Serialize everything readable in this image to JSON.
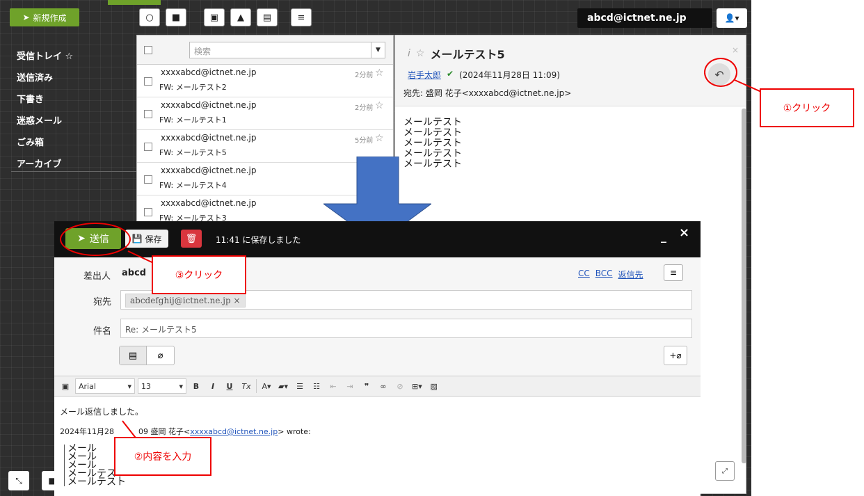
{
  "background": {
    "compose_label": "新規作成",
    "account": "abcd@ictnet.ne.jp",
    "folders": [
      {
        "label": "受信トレイ ☆"
      },
      {
        "label": "送信済み"
      },
      {
        "label": "下書き"
      },
      {
        "label": "迷惑メール"
      },
      {
        "label": "ごみ箱"
      },
      {
        "label": "アーカイブ"
      }
    ],
    "search_placeholder": "検索",
    "messages": [
      {
        "from": "xxxxabcd@ictnet.ne.jp",
        "subject": "FW: メールテスト2",
        "time": "2分前"
      },
      {
        "from": "xxxxabcd@ictnet.ne.jp",
        "subject": "FW: メールテスト1",
        "time": "2分前"
      },
      {
        "from": "xxxxabcd@ictnet.ne.jp",
        "subject": "FW: メールテスト5",
        "time": "5分前"
      },
      {
        "from": "xxxxabcd@ictnet.ne.jp",
        "subject": "FW: メールテスト4",
        "time": ""
      },
      {
        "from": "xxxxabcd@ictnet.ne.jp",
        "subject": "FW: メールテスト3",
        "time": ""
      }
    ],
    "reading": {
      "title": "メールテスト5",
      "sender": "岩手太郎",
      "date": "(2024年11月28日 11:09)",
      "to_label": "宛先:",
      "to_value": "盛岡 花子<xxxxabcd@ictnet.ne.jp>",
      "body": [
        "メールテスト",
        "メールテスト",
        "メールテスト",
        "メールテスト",
        "メールテスト"
      ]
    }
  },
  "compose": {
    "send_label": "送信",
    "save_label": "保存",
    "saved_time": "11:41",
    "saved_text": "に保存しました",
    "from_label": "差出人",
    "from_value": "abcd",
    "links": {
      "cc": "CC",
      "bcc": "BCC",
      "reply_to": "返信先"
    },
    "to_label": "宛先",
    "to_value": "abcdefghij@ictnet.ne.jp ×",
    "subject_label": "件名",
    "subject_value": "Re: メールテスト5",
    "toolbar": {
      "font": "Arial",
      "size": "13"
    },
    "body_line1": "メール返信しました。",
    "quote_intro_date": "2024年11月28",
    "quote_intro_mid": "09",
    "quote_intro_name": "盛岡 花子<",
    "quote_intro_email": "xxxxabcd@ictnet.ne.jp",
    "quote_intro_end": "> wrote:",
    "quote_lines": [
      "メール",
      "メール",
      "メール",
      "メールテスト",
      "メールテスト"
    ]
  },
  "annotations": {
    "step1": "①クリック",
    "step2": "②内容を入力",
    "step3": "③クリック"
  },
  "colors": {
    "accent_green": "#6fa22a",
    "annotation_red": "#ee0000",
    "arrow_blue": "#4472c4"
  }
}
